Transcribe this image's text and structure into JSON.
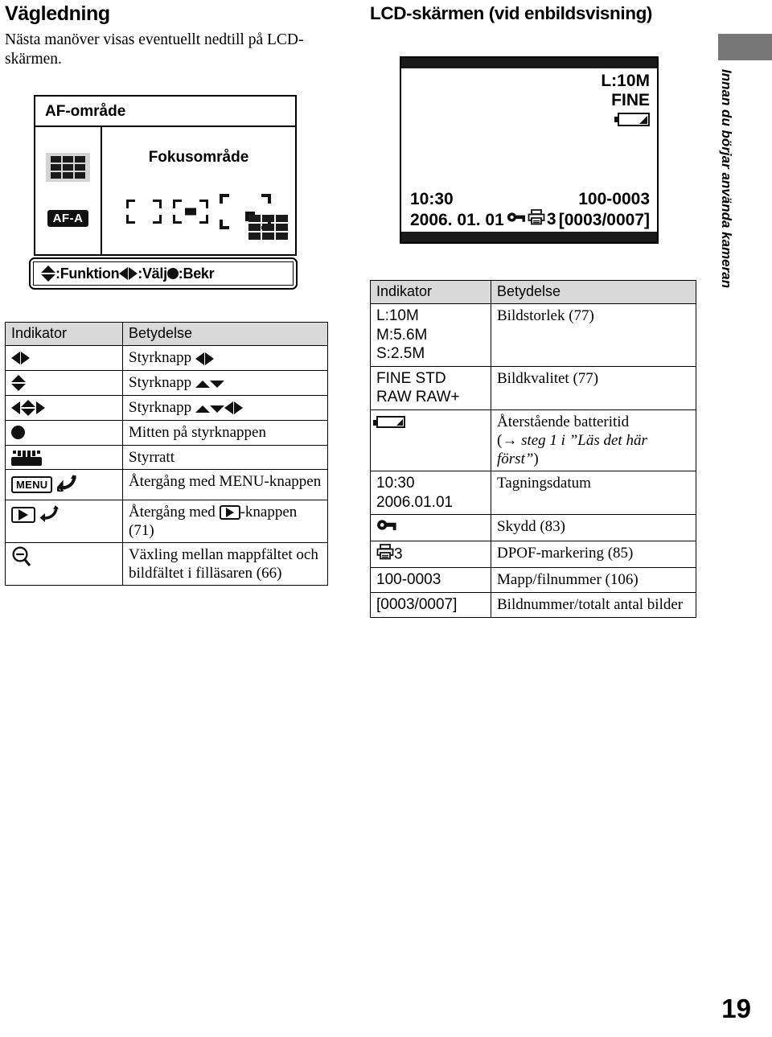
{
  "page": {
    "number": "19",
    "side_tab": "Innan du börjar använda kameran"
  },
  "left": {
    "title": "Vägledning",
    "intro": "Nästa manöver visas eventuellt nedtill på LCD-skärmen.",
    "af_screen": {
      "title": "AF-område",
      "mode_badge": "AF-A",
      "focus_label": "Fokusområde",
      "guide_bar": {
        "funktion": ":Funktion",
        "valj": ":Välj",
        "bekr": ":Bekr"
      }
    },
    "table": {
      "headers": [
        "Indikator",
        "Betydelse"
      ],
      "rows": [
        {
          "icon": "control-button-lr",
          "meaning_prefix": "Styrknapp",
          "meaning_suffix": "lr"
        },
        {
          "icon": "control-button-ud",
          "meaning_prefix": "Styrknapp",
          "meaning_suffix": "ud"
        },
        {
          "icon": "control-button-quad",
          "meaning_prefix": "Styrknapp",
          "meaning_suffix": "udlr"
        },
        {
          "icon": "center-dot",
          "meaning_prefix": "Mitten på styrknappen",
          "meaning_suffix": ""
        },
        {
          "icon": "control-dial",
          "meaning_prefix": "Styrratt",
          "meaning_suffix": ""
        },
        {
          "icon": "menu-return",
          "meaning_prefix": "Återgång med MENU-knappen",
          "meaning_suffix": ""
        },
        {
          "icon": "playback-return",
          "meaning_prefix_a": "Återgång med",
          "meaning_prefix_b": "-knappen (71)"
        },
        {
          "icon": "zoom-out",
          "meaning_prefix": "Växling mellan mappfältet och bildfältet i filläsaren (66)",
          "meaning_suffix": ""
        }
      ]
    }
  },
  "right": {
    "title": "LCD-skärmen (vid enbildsvisning)",
    "lcd": {
      "image_size": "L:10M",
      "quality": "FINE",
      "battery_icon": "battery-icon",
      "time": "10:30",
      "date": "2006. 01. 01",
      "protect_icon": "key-icon",
      "dpof_icon": "printer-icon",
      "dpof_count": "3",
      "folder_file": "100-0003",
      "image_index": "[0003/0007]"
    },
    "table": {
      "headers": [
        "Indikator",
        "Betydelse"
      ],
      "rows": [
        {
          "indicator_lines": [
            "L:10M",
            "M:5.6M",
            "S:2.5M"
          ],
          "meaning": "Bildstorlek (77)"
        },
        {
          "indicator_lines": [
            "FINE STD",
            "RAW RAW+"
          ],
          "meaning": "Bildkvalitet (77)"
        },
        {
          "indicator_icon": "battery-icon",
          "meaning_plain": "Återstående batteritid",
          "meaning_note_open": "(",
          "meaning_note_arrow": "→",
          "meaning_note_italic": "steg 1 i ”Läs det här först”",
          "meaning_note_close": ")"
        },
        {
          "indicator_lines": [
            "10:30",
            "2006.01.01"
          ],
          "meaning": "Tagningsdatum"
        },
        {
          "indicator_icon": "key-icon",
          "meaning": "Skydd (83)"
        },
        {
          "indicator_icon": "printer-icon",
          "indicator_suffix": "3",
          "meaning": "DPOF-markering (85)"
        },
        {
          "indicator_lines": [
            "100-0003"
          ],
          "meaning": "Mapp/filnummer (106)"
        },
        {
          "indicator_lines": [
            "[0003/0007]"
          ],
          "meaning": "Bildnummer/totalt antal bilder"
        }
      ]
    }
  },
  "colors": {
    "header_gray": "#d9d9d9",
    "tab_gray": "#777777",
    "highlight_gray": "#d4d4d4",
    "ink": "#000000"
  }
}
